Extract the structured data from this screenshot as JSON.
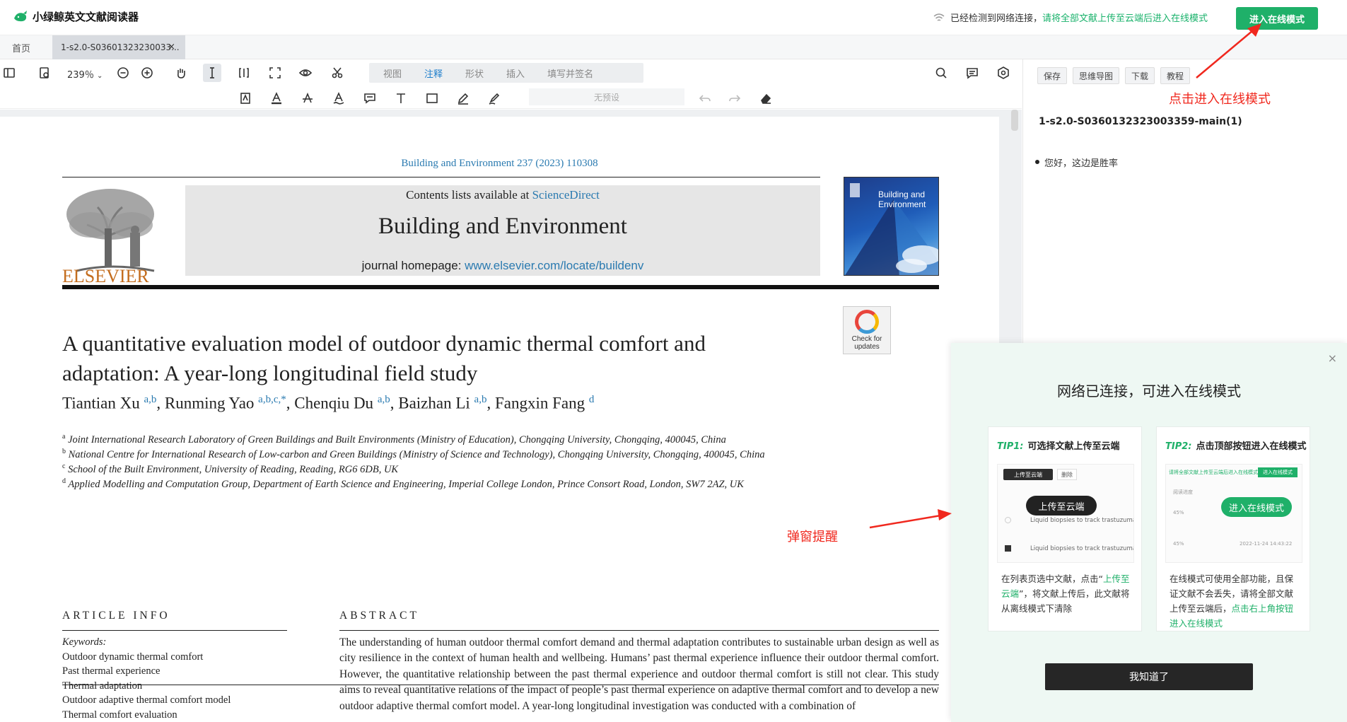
{
  "app": {
    "title": "小绿鲸英文文献阅读器",
    "network_status": "已经检测到网络连接，",
    "network_link": "请将全部文献上传至云端后进入在线模式",
    "online_button": "进入在线模式"
  },
  "tabs": {
    "home": "首页",
    "doc": "1-s2.0-S03601323230033...",
    "close": "×"
  },
  "toolbar": {
    "zoom": "239％",
    "modes": [
      "视图",
      "注释",
      "形状",
      "插入",
      "填写并签名"
    ],
    "active_mode": "注释",
    "preset": "无预设"
  },
  "document": {
    "journal_ref": "Building and Environment 237 (2023) 110308",
    "contents_prefix": "Contents lists available at ",
    "contents_link": "ScienceDirect",
    "journal_title": "Building and Environment",
    "homepage_prefix": "journal homepage: ",
    "homepage_link": "www.elsevier.com/locate/buildenv",
    "publisher": "ELSEVIER",
    "cover_title_1": "Building and",
    "cover_title_2": "Environment",
    "check_updates_1": "Check for",
    "check_updates_2": "updates",
    "title_line1": "A quantitative evaluation model of outdoor dynamic thermal comfort and",
    "title_line2": "adaptation: A year-long longitudinal field study",
    "authors": [
      {
        "name": "Tiantian Xu",
        "sup": "a,b"
      },
      {
        "name": "Runming Yao",
        "sup": "a,b,c,*"
      },
      {
        "name": "Chenqiu Du",
        "sup": "a,b"
      },
      {
        "name": "Baizhan Li",
        "sup": "a,b"
      },
      {
        "name": "Fangxin Fang",
        "sup": "d"
      }
    ],
    "affiliations": [
      {
        "sup": "a",
        "text": "Joint International Research Laboratory of Green Buildings and Built Environments (Ministry of Education), Chongqing University, Chongqing, 400045, China"
      },
      {
        "sup": "b",
        "text": "National Centre for International Research of Low-carbon and Green Buildings (Ministry of Science and Technology), Chongqing University, Chongqing, 400045, China"
      },
      {
        "sup": "c",
        "text": "School of the Built Environment, University of Reading, Reading, RG6 6DB, UK"
      },
      {
        "sup": "d",
        "text": "Applied Modelling and Computation Group, Department of Earth Science and Engineering, Imperial College London, Prince Consort Road, London, SW7 2AZ, UK"
      }
    ],
    "article_info_head": "ARTICLE INFO",
    "abstract_head": "ABSTRACT",
    "keywords_head": "Keywords:",
    "keywords": [
      "Outdoor dynamic thermal comfort",
      "Past thermal experience",
      "Thermal adaptation",
      "Outdoor adaptive thermal comfort model",
      "Thermal comfort evaluation"
    ],
    "abstract": "The understanding of human outdoor thermal comfort demand and thermal adaptation contributes to sustainable urban design as well as city resilience in the context of human health and wellbeing. Humans’ past thermal experience influence their outdoor thermal comfort. However, the quantitative relationship between the past thermal experience and outdoor thermal comfort is still not clear. This study aims to reveal quantitative relations of the impact of people’s past thermal experience on adaptive thermal comfort and to develop a new outdoor adaptive thermal comfort model. A year-long longitudinal investigation was conducted with a combination of"
  },
  "right_panel": {
    "buttons": [
      "保存",
      "思维导图",
      "下载",
      "教程"
    ],
    "doc_title": "1-s2.0-S0360132323003359-main(1)",
    "note": "您好，这边是胜率"
  },
  "popup": {
    "close": "×",
    "title": "网络已连接，可进入在线模式",
    "tip1": {
      "num": "TIP1:",
      "head": "可选择文献上传至云端",
      "ill_btn1": "上传至云端",
      "ill_btn2": "删除",
      "ill_pill": "上传至云端",
      "ill_row1": "Liquid biopsies to track trastuzumal",
      "ill_row2": "Liquid biopsies to track trastuzumal",
      "desc_pre": "在列表页选中文献，点击“",
      "desc_link": "上传至云端",
      "desc_post": "”，将文献上传后，此文献将从离线模式下清除"
    },
    "tip2": {
      "num": "TIP2:",
      "head": "点击顶部按钮进入在线模式",
      "ill_top_text": "请将全部文献上传至云端后进入在线模式",
      "ill_top_btn": "进入在线模式",
      "ill_pill": "进入在线模式",
      "ill_label": "阅读进度",
      "ill_p1": "45%",
      "ill_p2": "45%",
      "ill_date": "2022-11-24 14:43:22",
      "desc_pre": "在线模式可使用全部功能，且保证文献不会丢失，请将全部文献上传至云端后，",
      "desc_link": "点击右上角按钮进入在线模式"
    },
    "got_it": "我知道了"
  },
  "annotations": {
    "online_hint": "点击进入在线模式",
    "popup_hint": "弹窗提醒"
  },
  "colors": {
    "accent_green": "#1fb069",
    "link_blue": "#2a7ab0",
    "annotation_red": "#f0281e",
    "elsevier_orange": "#c46d1e"
  }
}
